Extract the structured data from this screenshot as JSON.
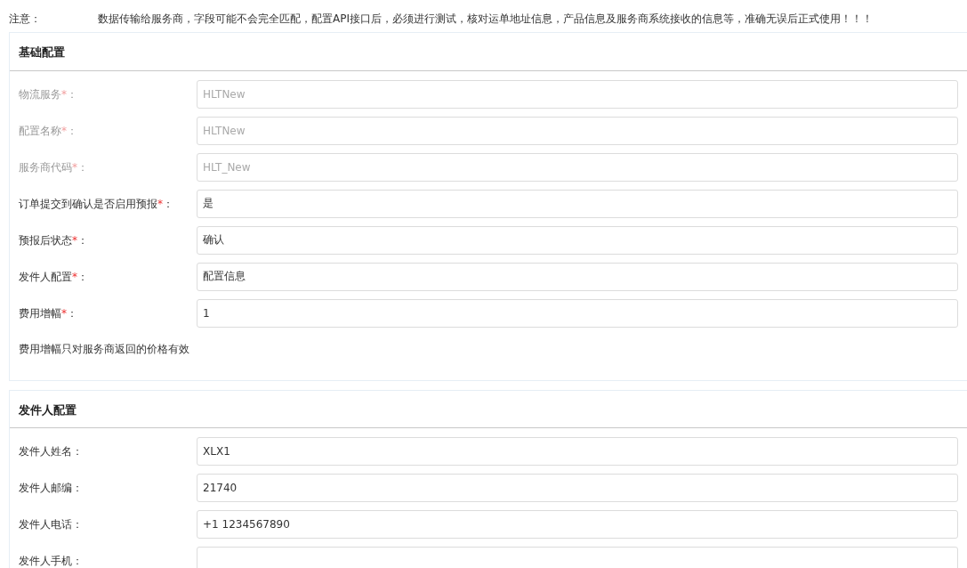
{
  "notice": {
    "label": "注意：",
    "text": "数据传输给服务商，字段可能不会完全匹配，配置API接口后，必须进行测试，核对运单地址信息，产品信息及服务商系统接收的信息等，准确无误后正式使用！！！"
  },
  "sections": [
    {
      "title": "基础配置",
      "fields": [
        {
          "label": "物流服务",
          "star": "*",
          "colon": "：",
          "value": "HLTNew",
          "disabled": true
        },
        {
          "label": "配置名称",
          "star": "*",
          "colon": "：",
          "value": "HLTNew",
          "disabled": true
        },
        {
          "label": "服务商代码",
          "star": "*",
          "colon": "：",
          "value": "HLT_New",
          "disabled": true
        },
        {
          "label": "订单提交到确认是否启用预报",
          "star": "*",
          "colon": "：",
          "value": "是",
          "disabled": false
        },
        {
          "label": "预报后状态",
          "star": "*",
          "colon": "：",
          "value": "确认",
          "disabled": false
        },
        {
          "label": "发件人配置",
          "star": "*",
          "colon": "：",
          "value": "配置信息",
          "disabled": false
        },
        {
          "label": "费用增幅",
          "star": "*",
          "colon": "：",
          "value": "1",
          "disabled": false
        }
      ],
      "note": "费用增幅只对服务商返回的价格有效"
    },
    {
      "title": "发件人配置",
      "fields": [
        {
          "label": "发件人姓名",
          "colon": "：",
          "value": "XLX1",
          "disabled": false
        },
        {
          "label": "发件人邮编",
          "colon": "：",
          "value": "21740",
          "disabled": false
        },
        {
          "label": "发件人电话",
          "colon": "：",
          "value": "+1 1234567890",
          "disabled": false
        },
        {
          "label": "发件人手机",
          "colon": "：",
          "disabled": false
        }
      ]
    }
  ]
}
